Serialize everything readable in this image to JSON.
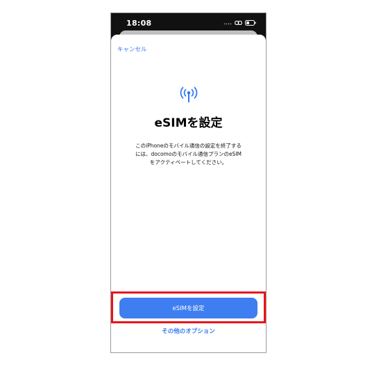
{
  "status_bar": {
    "time": "18:08"
  },
  "nav": {
    "cancel_label": "キャンセル"
  },
  "content": {
    "icon": "antenna-icon",
    "title": "eSIMを設定",
    "description_lines": [
      "このiPhoneのモバイル通信の設定を終了する",
      "には、docomoのモバイル通信プランのeSIM",
      "をアクティベートしてください。"
    ]
  },
  "actions": {
    "primary_label": "eSIMを設定",
    "secondary_label": "その他のオプション"
  },
  "colors": {
    "accent": "#3478f6",
    "button": "#3f7ef0",
    "highlight": "#e8141b"
  }
}
